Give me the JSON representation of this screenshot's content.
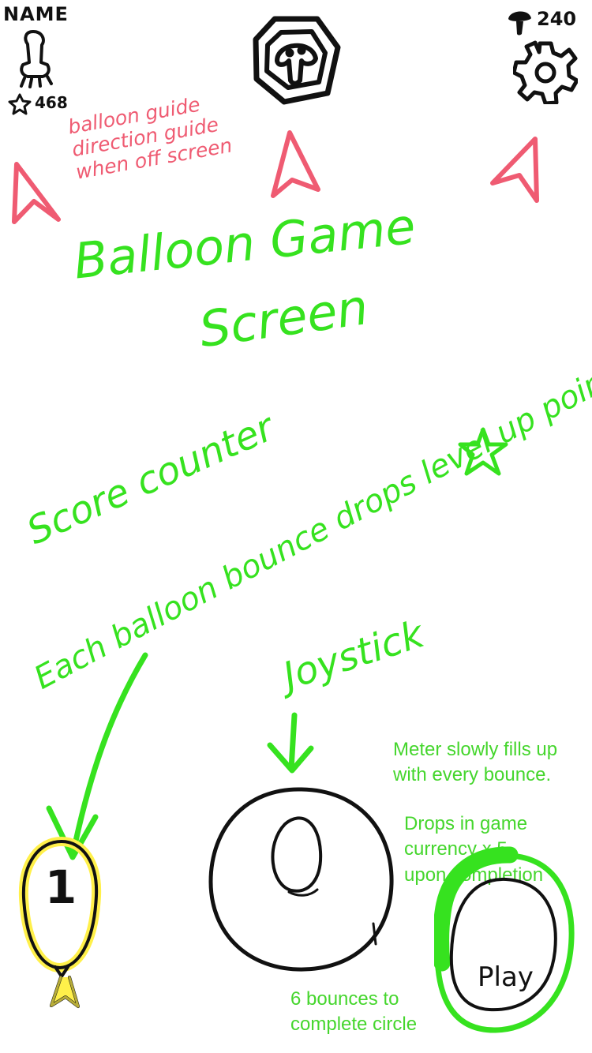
{
  "top_bar": {
    "player_name": "NAME",
    "level_points": "468",
    "currency_count": "240",
    "emblem_icon": "mushroom-emblem-icon",
    "settings_icon": "gear-icon"
  },
  "annotations": {
    "direction_guide_lines": [
      "balloon guide",
      "direction guide",
      "when off screen"
    ],
    "screen_title_line_1": "Balloon Game",
    "screen_title_line_2": "Screen",
    "score_note_line_1": "Score counter",
    "score_note_line_2": "Each balloon bounce drops level up points",
    "joystick_label": "Joystick",
    "meter_note_lines": [
      "Meter slowly fills up",
      "with every bounce."
    ],
    "drop_note_lines": [
      "Drops in game",
      "currency x 5",
      "upon completion"
    ],
    "bounces_note_lines": [
      "6 bounces to",
      "complete circle"
    ]
  },
  "gameplay": {
    "score_value": "1",
    "play_button_label": "Play",
    "meter_fill_fraction": 0.33,
    "joystick_state": "idle"
  },
  "colors": {
    "guide_pink": "#ef5b72",
    "note_green": "#36e21f",
    "highlight_yellow": "#fff04a",
    "ink": "#111111"
  }
}
